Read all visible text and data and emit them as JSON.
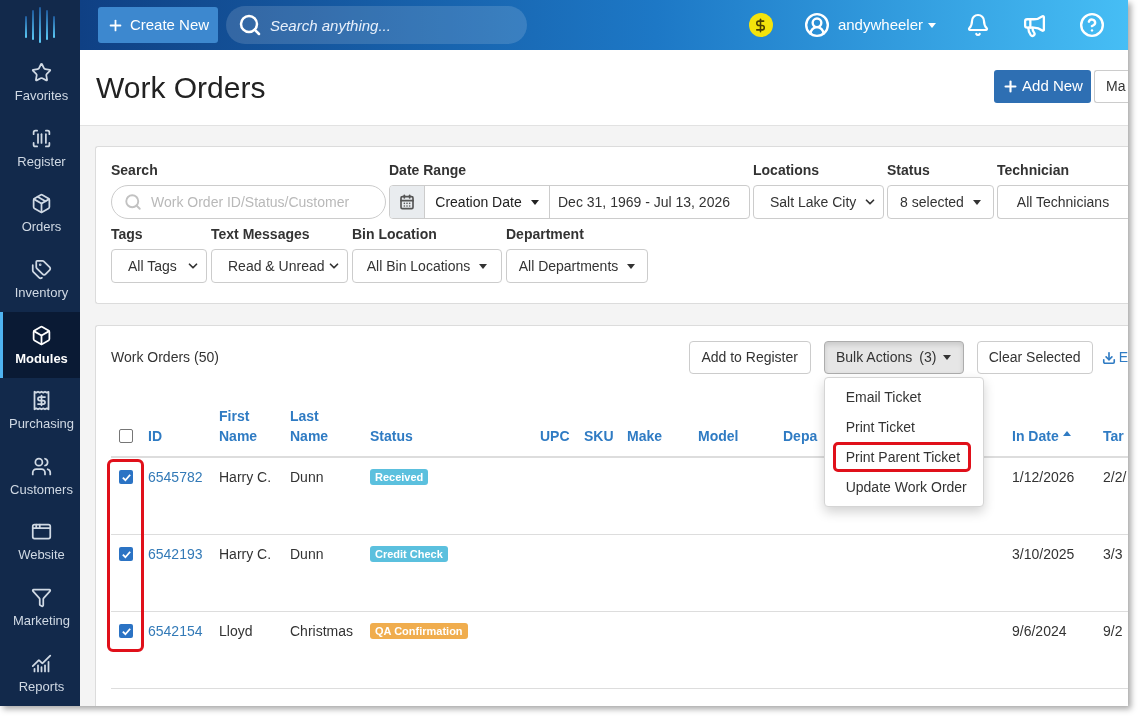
{
  "topbar": {
    "create_button": "Create New",
    "search": {
      "placeholder": "Search anything..."
    },
    "user": {
      "name": "andywheeler"
    }
  },
  "sidebar": {
    "items": [
      {
        "label": "Favorites",
        "selected": false
      },
      {
        "label": "Register",
        "selected": false
      },
      {
        "label": "Orders",
        "selected": false
      },
      {
        "label": "Inventory",
        "selected": false
      },
      {
        "label": "Modules",
        "selected": true
      },
      {
        "label": "Purchasing",
        "selected": false
      },
      {
        "label": "Customers",
        "selected": false
      },
      {
        "label": "Website",
        "selected": false
      },
      {
        "label": "Marketing",
        "selected": false
      },
      {
        "label": "Reports",
        "selected": false
      }
    ]
  },
  "page": {
    "title": "Work Orders",
    "buttons": [
      {
        "label": "Add New",
        "kind": "primary"
      },
      {
        "label": "Ma",
        "kind": "default"
      }
    ]
  },
  "filters": {
    "rows": [
      {
        "fields": [
          {
            "label": "Search",
            "kind": "search",
            "placeholder": "Work Order ID/Status/Customer"
          },
          {
            "label": "Date Range",
            "kind": "date_range",
            "type": "Creation Date",
            "value": "Dec 31, 1969 - Jul 13, 2026"
          },
          {
            "label": "Locations",
            "kind": "select",
            "value": "Salt Lake City"
          },
          {
            "label": "Status",
            "kind": "dropdown",
            "value": "8 selected"
          },
          {
            "label": "Technician",
            "kind": "plain",
            "value": "All Technicians"
          }
        ]
      },
      {
        "fields": [
          {
            "label": "Tags",
            "kind": "select",
            "value": "All Tags"
          },
          {
            "label": "Text Messages",
            "kind": "select",
            "value": "Read & Unread"
          },
          {
            "label": "Bin Location",
            "kind": "dropdown",
            "value": "All Bin Locations"
          },
          {
            "label": "Department",
            "kind": "dropdown",
            "value": "All Departments"
          }
        ]
      }
    ]
  },
  "work_orders": {
    "title": "Work Orders (50)",
    "toolbar": [
      {
        "kind": "button",
        "label": "Add to Register"
      },
      {
        "kind": "menu",
        "label": "Bulk Actions",
        "count": "(3)",
        "open": true,
        "items": [
          {
            "label": "Email Ticket",
            "outlined": false
          },
          {
            "label": "Print Ticket",
            "outlined": false
          },
          {
            "label": "Print Parent Ticket",
            "outlined": true
          },
          {
            "label": "Update Work Order",
            "outlined": false
          }
        ]
      },
      {
        "kind": "button",
        "label": "Clear Selected"
      },
      {
        "kind": "export",
        "label": "E"
      }
    ],
    "table": {
      "select_all": {
        "checked": false
      },
      "checkbox_column_outlined": true,
      "columns": [
        {
          "label": "ID",
          "sorted": false
        },
        {
          "label": "First Name",
          "sorted": false
        },
        {
          "label": "Last Name",
          "sorted": false
        },
        {
          "label": "Status",
          "sorted": false
        },
        {
          "label": "UPC",
          "sorted": false
        },
        {
          "label": "SKU",
          "sorted": false
        },
        {
          "label": "Make",
          "sorted": false
        },
        {
          "label": "Model",
          "sorted": false
        },
        {
          "label": "Depa",
          "sorted": false
        },
        {
          "label": "In Date",
          "sorted": true
        },
        {
          "label": "Tar",
          "sorted": false
        }
      ],
      "rows": [
        {
          "checked": true,
          "id": "6545782",
          "first_name": "Harry C.",
          "last_name": "Dunn",
          "status": {
            "label": "Received",
            "color": "#5bc0de"
          },
          "in_date": "1/12/2026",
          "column_12": "2/2/"
        },
        {
          "checked": true,
          "id": "6542193",
          "first_name": "Harry C.",
          "last_name": "Dunn",
          "status": {
            "label": "Credit Check",
            "color": "#5bc0de"
          },
          "in_date": "3/10/2025",
          "column_12": "3/3"
        },
        {
          "checked": true,
          "id": "6542154",
          "first_name": "Lloyd",
          "last_name": "Christmas",
          "status": {
            "label": "QA Confirmation",
            "color": "#f0ad4e"
          },
          "in_date": "9/6/2024",
          "column_12": "9/2"
        }
      ]
    }
  }
}
